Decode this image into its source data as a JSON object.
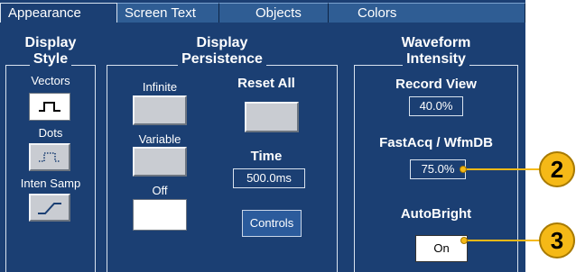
{
  "tabs": [
    "Appearance",
    "Screen Text",
    "Objects",
    "Colors"
  ],
  "display_style": {
    "title_line1": "Display",
    "title_line2": "Style",
    "vectors_label": "Vectors",
    "dots_label": "Dots",
    "inten_samp_label": "Inten Samp"
  },
  "persistence": {
    "title_line1": "Display",
    "title_line2": "Persistence",
    "infinite_label": "Infinite",
    "variable_label": "Variable",
    "off_label": "Off",
    "reset_all_label": "Reset All",
    "time_label": "Time",
    "time_value": "500.0ms",
    "controls_label": "Controls"
  },
  "intensity": {
    "title_line1": "Waveform",
    "title_line2": "Intensity",
    "record_view_label": "Record View",
    "record_view_value": "40.0%",
    "fastacq_label": "FastAcq / WfmDB",
    "fastacq_value": "75.0%",
    "autobright_label": "AutoBright",
    "autobright_value": "On"
  },
  "callouts": [
    "2",
    "3"
  ],
  "colors": {
    "panel_bg": "#1b3f73",
    "callout": "#f5b917"
  }
}
